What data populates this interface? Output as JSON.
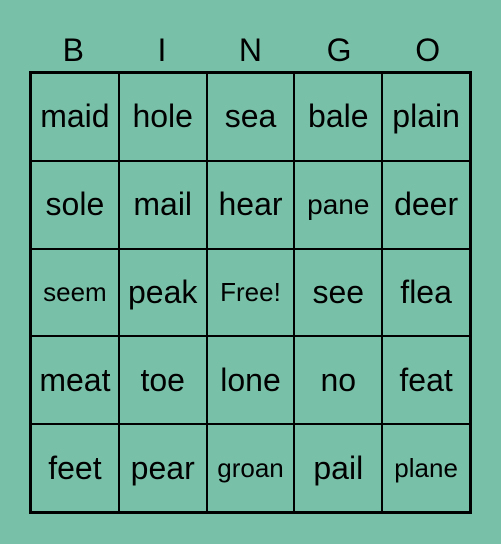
{
  "header": [
    "B",
    "I",
    "N",
    "G",
    "O"
  ],
  "cells": [
    "maid",
    "hole",
    "sea",
    "bale",
    "plain",
    "sole",
    "mail",
    "hear",
    "pane",
    "deer",
    "seem",
    "peak",
    "Free!",
    "see",
    "flea",
    "meat",
    "toe",
    "lone",
    "no",
    "feat",
    "feet",
    "pear",
    "groan",
    "pail",
    "plane"
  ],
  "colors": {
    "background": "#79c0a9",
    "lines": "#000000"
  }
}
